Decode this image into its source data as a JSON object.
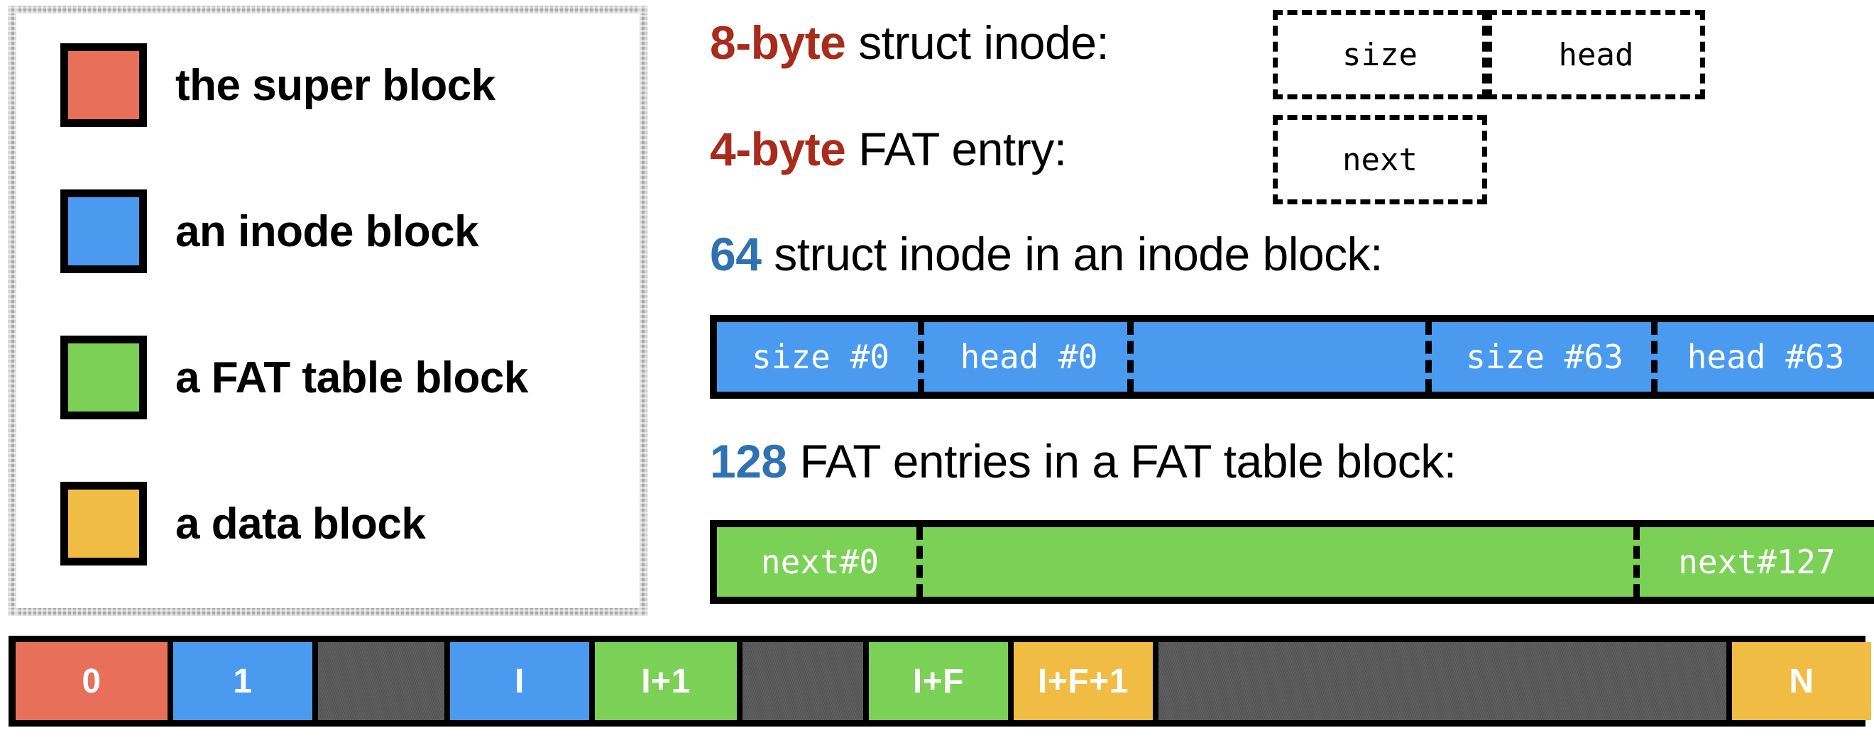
{
  "legend": {
    "items": [
      {
        "label": "the super block",
        "color": "#e8705a",
        "icon": "square-swatch-icon"
      },
      {
        "label": "an inode block",
        "color": "#4a9bf0",
        "icon": "square-swatch-icon"
      },
      {
        "label": "a FAT table block",
        "color": "#7bd155",
        "icon": "square-swatch-icon"
      },
      {
        "label": "a data block",
        "color": "#f0bc44",
        "icon": "square-swatch-icon"
      }
    ]
  },
  "struct_inode": {
    "accent": "8-byte",
    "rest": " struct inode:",
    "accent_color": "#a82b1b",
    "fields": [
      {
        "label": "size"
      },
      {
        "label": "head"
      }
    ]
  },
  "fat_entry": {
    "accent": "4-byte",
    "rest": " FAT entry:",
    "accent_color": "#a82b1b",
    "fields": [
      {
        "label": "next"
      }
    ]
  },
  "inode_block": {
    "accent": "64",
    "rest": " struct inode in an inode block:",
    "accent_color": "#2e72b0",
    "block_color": "#4a9bf0",
    "cells": [
      {
        "label": "size #0"
      },
      {
        "label": "head #0"
      },
      {
        "label": ""
      },
      {
        "label": "size #63"
      },
      {
        "label": "head #63"
      }
    ]
  },
  "fat_block": {
    "accent": "128",
    "rest": " FAT entries in a FAT table block:",
    "accent_color": "#2e72b0",
    "block_color": "#7bd155",
    "cells": [
      {
        "label": "next#0"
      },
      {
        "label": ""
      },
      {
        "label": "next#127"
      }
    ]
  },
  "disk_layout": {
    "segments": [
      {
        "label": "0",
        "kind": "super"
      },
      {
        "label": "1",
        "kind": "inode"
      },
      {
        "label": "",
        "kind": "gap"
      },
      {
        "label": "I",
        "kind": "inode"
      },
      {
        "label": "I+1",
        "kind": "fat"
      },
      {
        "label": "",
        "kind": "gap"
      },
      {
        "label": "I+F",
        "kind": "fat"
      },
      {
        "label": "I+F+1",
        "kind": "data"
      },
      {
        "label": "",
        "kind": "gap"
      },
      {
        "label": "N",
        "kind": "data"
      }
    ]
  }
}
